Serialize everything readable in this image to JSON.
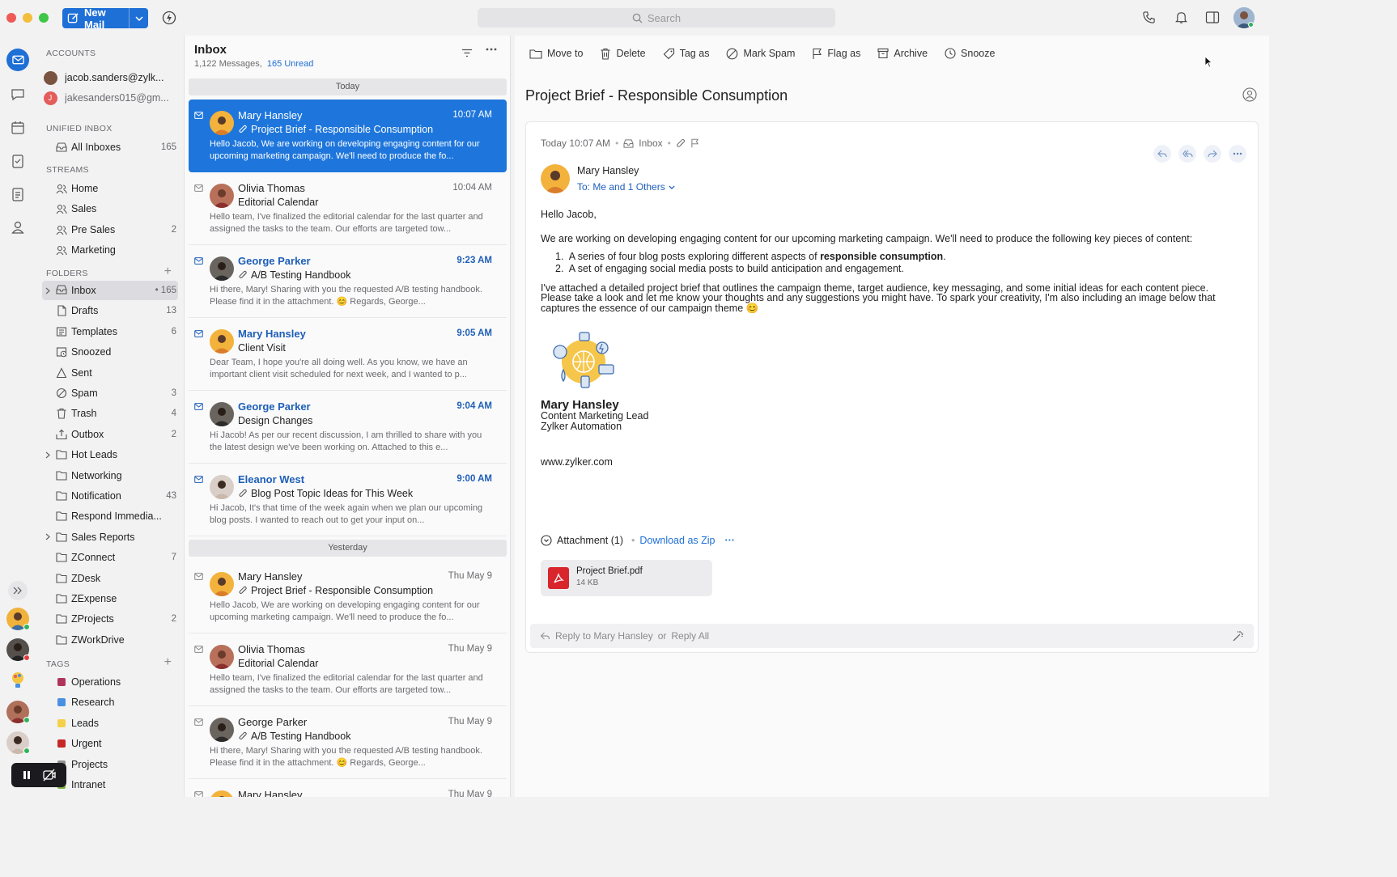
{
  "toolbar_top": {
    "new_mail_label": "New Mail",
    "search_placeholder": "Search"
  },
  "accounts": {
    "heading": "ACCOUNTS",
    "items": [
      "jacob.sanders@zylk...",
      "jakesanders015@gm..."
    ]
  },
  "unified": {
    "heading": "UNIFIED INBOX",
    "all_label": "All Inboxes",
    "all_count": "165"
  },
  "streams": {
    "heading": "STREAMS",
    "items": [
      {
        "label": "Home",
        "count": ""
      },
      {
        "label": "Sales",
        "count": ""
      },
      {
        "label": "Pre Sales",
        "count": "2"
      },
      {
        "label": "Marketing",
        "count": ""
      }
    ]
  },
  "folders": {
    "heading": "FOLDERS",
    "items": [
      {
        "label": "Inbox",
        "count": "• 165"
      },
      {
        "label": "Drafts",
        "count": "13"
      },
      {
        "label": "Templates",
        "count": "6"
      },
      {
        "label": "Snoozed",
        "count": ""
      },
      {
        "label": "Sent",
        "count": ""
      },
      {
        "label": "Spam",
        "count": "3"
      },
      {
        "label": "Trash",
        "count": "4"
      },
      {
        "label": "Outbox",
        "count": "2"
      },
      {
        "label": "Hot Leads",
        "count": ""
      },
      {
        "label": "Networking",
        "count": ""
      },
      {
        "label": "Notification",
        "count": "43"
      },
      {
        "label": "Respond Immedia...",
        "count": ""
      },
      {
        "label": "Sales Reports",
        "count": ""
      },
      {
        "label": "ZConnect",
        "count": "7"
      },
      {
        "label": "ZDesk",
        "count": ""
      },
      {
        "label": "ZExpense",
        "count": ""
      },
      {
        "label": "ZProjects",
        "count": "2"
      },
      {
        "label": "ZWorkDrive",
        "count": ""
      }
    ]
  },
  "tags": {
    "heading": "TAGS",
    "items": [
      {
        "label": "Operations",
        "color": "#b0335a"
      },
      {
        "label": "Research",
        "color": "#4a90e2"
      },
      {
        "label": "Leads",
        "color": "#f5d04a"
      },
      {
        "label": "Urgent",
        "color": "#c62828"
      },
      {
        "label": "Projects",
        "color": "#8e8e93"
      },
      {
        "label": "Intranet",
        "color": "#7cb342"
      }
    ]
  },
  "list": {
    "title": "Inbox",
    "count_text": "1,122 Messages,",
    "unread_text": "165 Unread",
    "day_today": "Today",
    "day_yesterday": "Yesterday",
    "messages": [
      {
        "from": "Mary Hansley",
        "time": "10:07 AM",
        "subject": "Project Brief - Responsible Consumption",
        "preview": "Hello Jacob, We are working on developing engaging content for our upcoming marketing campaign. We'll need to produce the fo...",
        "attach": true
      },
      {
        "from": "Olivia Thomas",
        "time": "10:04 AM",
        "subject": "Editorial Calendar",
        "preview": "Hello team, I've finalized the editorial calendar for the last quarter and assigned the tasks to the team. Our efforts are targeted tow...",
        "attach": false
      },
      {
        "from": "George Parker",
        "time": "9:23 AM",
        "subject": "A/B Testing Handbook",
        "preview": "Hi there, Mary! Sharing with you the requested A/B testing handbook. Please find it in the attachment. 😊 Regards, George...",
        "attach": true
      },
      {
        "from": "Mary Hansley",
        "time": "9:05 AM",
        "subject": "Client Visit",
        "preview": "Dear Team, I hope you're all doing well. As you know, we have an important client visit scheduled for next week, and I wanted to p...",
        "attach": false
      },
      {
        "from": "George Parker",
        "time": "9:04 AM",
        "subject": "Design Changes",
        "preview": "Hi Jacob! As per our recent discussion, I am thrilled to share with you the latest design we've been working on. Attached to this e...",
        "attach": false
      },
      {
        "from": "Eleanor West",
        "time": "9:00 AM",
        "subject": "Blog Post Topic Ideas for This Week",
        "preview": "Hi Jacob, It's that time of the week again when we plan our upcoming blog posts. I wanted to reach out to get your input on...",
        "attach": true
      },
      {
        "from": "Mary Hansley",
        "time": "Thu May 9",
        "subject": "Project Brief - Responsible Consumption",
        "preview": "Hello Jacob, We are working on developing engaging content for our upcoming marketing campaign. We'll need to produce the fo...",
        "attach": true
      },
      {
        "from": "Olivia Thomas",
        "time": "Thu May 9",
        "subject": "Editorial Calendar",
        "preview": "Hello team, I've finalized the editorial calendar for the last quarter and assigned the tasks to the team. Our efforts are targeted tow...",
        "attach": false
      },
      {
        "from": "George Parker",
        "time": "Thu May 9",
        "subject": "A/B Testing Handbook",
        "preview": "Hi there, Mary! Sharing with you the requested A/B testing handbook. Please find it in the attachment. 😊 Regards, George...",
        "attach": true
      },
      {
        "from": "Mary Hansley",
        "time": "Thu May 9",
        "subject": "",
        "preview": "",
        "attach": false
      }
    ]
  },
  "reader_toolbar": {
    "move_to": "Move to",
    "delete": "Delete",
    "tag_as": "Tag as",
    "mark_spam": "Mark Spam",
    "flag_as": "Flag as",
    "archive": "Archive",
    "snooze": "Snooze"
  },
  "email": {
    "subject": "Project Brief - Responsible Consumption",
    "date": "Today 10:07 AM",
    "folder": "Inbox",
    "sender": "Mary Hansley",
    "to": "To: Me and 1 Others",
    "greeting": "Hello Jacob,",
    "para1": "We are working on developing engaging content for our upcoming marketing campaign. We'll need to produce the following key pieces of content:",
    "item1_pre": "A series of four blog posts exploring different aspects of ",
    "item1_bold": "responsible consumption",
    "item1_post": ".",
    "item2": "A set of engaging social media posts to build anticipation and engagement.",
    "para2": "I've attached a detailed project brief that outlines the campaign theme, target audience, key messaging, and some initial ideas for each content piece. Please take a look and let me know your thoughts and any suggestions you might have. To spark your creativity, I'm also including an image below that captures the essence of our campaign theme 😊",
    "sig_name": "Mary Hansley",
    "sig_role": "Content Marketing Lead",
    "sig_company": "Zylker Automation",
    "website": "www.zylker.com",
    "attachment_label": "Attachment (1)",
    "download_zip": "Download as Zip",
    "file_name": "Project Brief.pdf",
    "file_size": "14 KB",
    "reply_to": "Reply to Mary Hansley",
    "reply_or": "or",
    "reply_all": "Reply All"
  },
  "colors": {
    "accent": "#1e6fd6",
    "selected_row": "#1e76dc",
    "unread_blue": "#1e5fb8"
  }
}
